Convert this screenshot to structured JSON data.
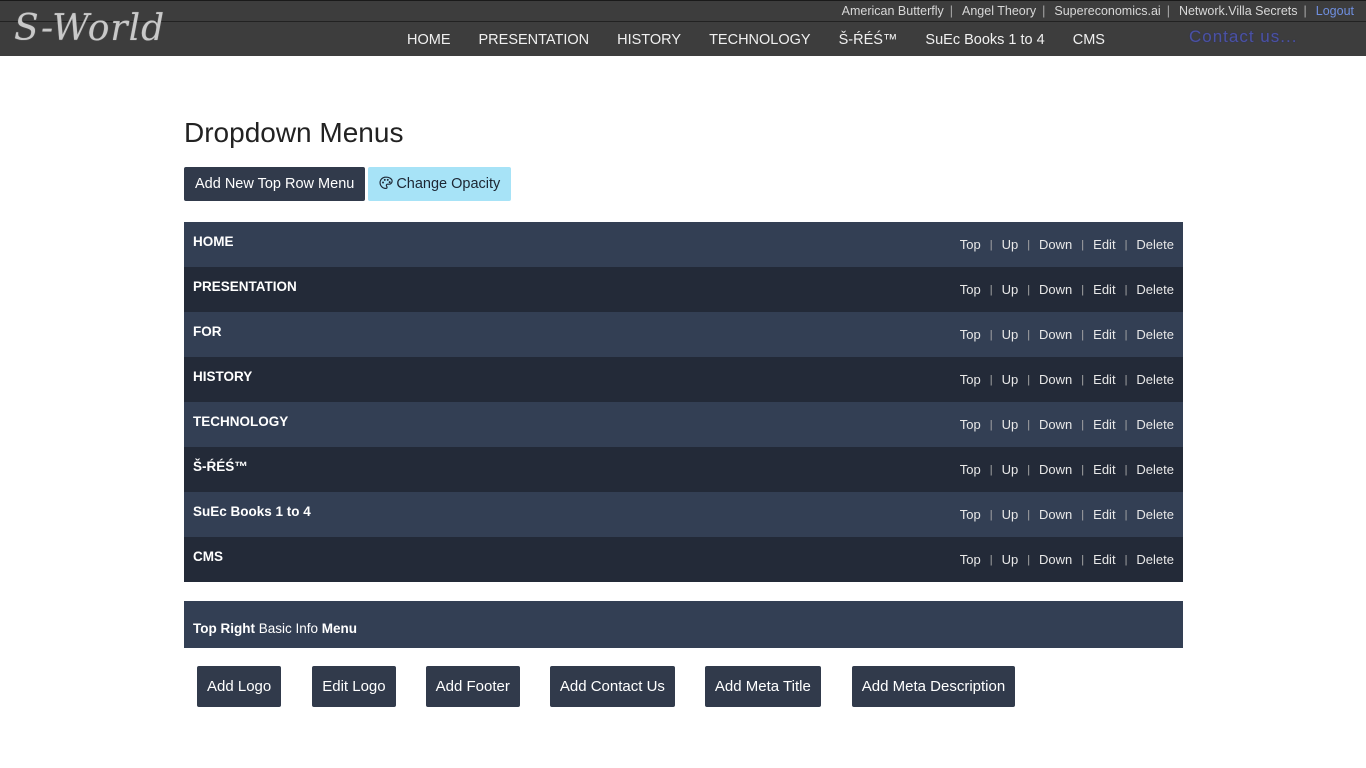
{
  "header": {
    "logo_text": "S-World",
    "top_links": [
      {
        "label": "American Butterfly"
      },
      {
        "label": "Angel Theory"
      },
      {
        "label": "Supereconomics.ai"
      },
      {
        "label": "Network.Villa Secrets"
      }
    ],
    "logout_label": "Logout",
    "nav": [
      "HOME",
      "PRESENTATION",
      "HISTORY",
      "TECHNOLOGY",
      "Š-ŔÉŚ™",
      "SuEc Books 1 to 4",
      "CMS"
    ],
    "contact_label": "Contact us..."
  },
  "page": {
    "title": "Dropdown Menus",
    "add_menu_label": "Add New Top Row Menu",
    "change_opacity_label": "Change Opacity"
  },
  "menu_ops": {
    "top": "Top",
    "up": "Up",
    "down": "Down",
    "edit": "Edit",
    "delete": "Delete"
  },
  "menus": [
    {
      "name": "HOME"
    },
    {
      "name": "PRESENTATION"
    },
    {
      "name": "FOR"
    },
    {
      "name": "HISTORY"
    },
    {
      "name": "TECHNOLOGY"
    },
    {
      "name": "Š-ŔÉŚ™"
    },
    {
      "name": "SuEc Books 1 to 4"
    },
    {
      "name": "CMS"
    }
  ],
  "basic_info": {
    "part1": "Top Right",
    "part2": " Basic Info ",
    "part3": "Menu"
  },
  "bottom_buttons": [
    "Add Logo",
    "Edit Logo",
    "Add Footer",
    "Add Contact Us",
    "Add Meta Title",
    "Add Meta Description"
  ],
  "colors": {
    "topbar": "#3d3d3d",
    "row_odd": "#333f54",
    "row_even": "#232a38",
    "button_dark": "#313a4b",
    "button_light": "#a7e3f7",
    "logout": "#6f8fe0",
    "contact": "#4b52a3"
  }
}
